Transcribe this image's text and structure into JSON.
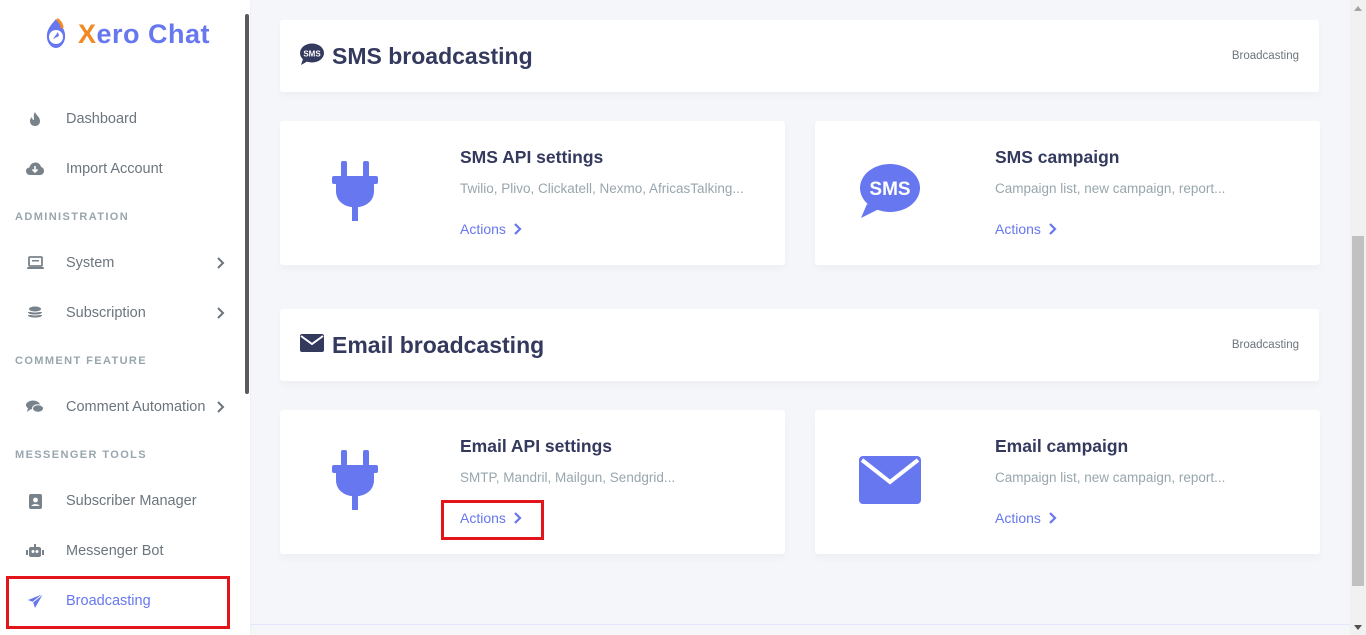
{
  "brand": {
    "logo_x": "X",
    "logo_rest": "ero Chat"
  },
  "sidebar": {
    "items_top": [
      {
        "label": "Dashboard",
        "icon": "fire-icon"
      },
      {
        "label": "Import Account",
        "icon": "cloud-download-icon"
      }
    ],
    "sections": [
      {
        "header": "ADMINISTRATION",
        "items": [
          {
            "label": "System",
            "icon": "laptop-icon"
          },
          {
            "label": "Subscription",
            "icon": "coins-icon"
          }
        ]
      },
      {
        "header": "COMMENT FEATURE",
        "items": [
          {
            "label": "Comment Automation",
            "icon": "comments-icon"
          }
        ]
      },
      {
        "header": "MESSENGER TOOLS",
        "items": [
          {
            "label": "Subscriber Manager",
            "icon": "address-card-icon"
          },
          {
            "label": "Messenger Bot",
            "icon": "robot-icon"
          },
          {
            "label": "Broadcasting",
            "icon": "paper-plane-icon",
            "active": true
          }
        ]
      }
    ]
  },
  "sms_section": {
    "title": "SMS broadcasting",
    "breadcrumb": "Broadcasting",
    "cards": [
      {
        "title": "SMS API settings",
        "desc": "Twilio, Plivo, Clickatell, Nexmo, AfricasTalking...",
        "actions": "Actions",
        "icon": "plug-icon"
      },
      {
        "title": "SMS campaign",
        "desc": "Campaign list, new campaign, report...",
        "actions": "Actions",
        "icon": "sms-bubble-icon"
      }
    ]
  },
  "email_section": {
    "title": "Email broadcasting",
    "breadcrumb": "Broadcasting",
    "cards": [
      {
        "title": "Email API settings",
        "desc": "SMTP, Mandril, Mailgun, Sendgrid...",
        "actions": "Actions",
        "icon": "plug-icon"
      },
      {
        "title": "Email campaign",
        "desc": "Campaign list, new campaign, report...",
        "actions": "Actions",
        "icon": "envelope-icon"
      }
    ]
  },
  "sms_icon_text": "SMS",
  "colors": {
    "accent": "#6777ef",
    "highlight": "#e3151c",
    "logo_orange": "#f08a24"
  }
}
